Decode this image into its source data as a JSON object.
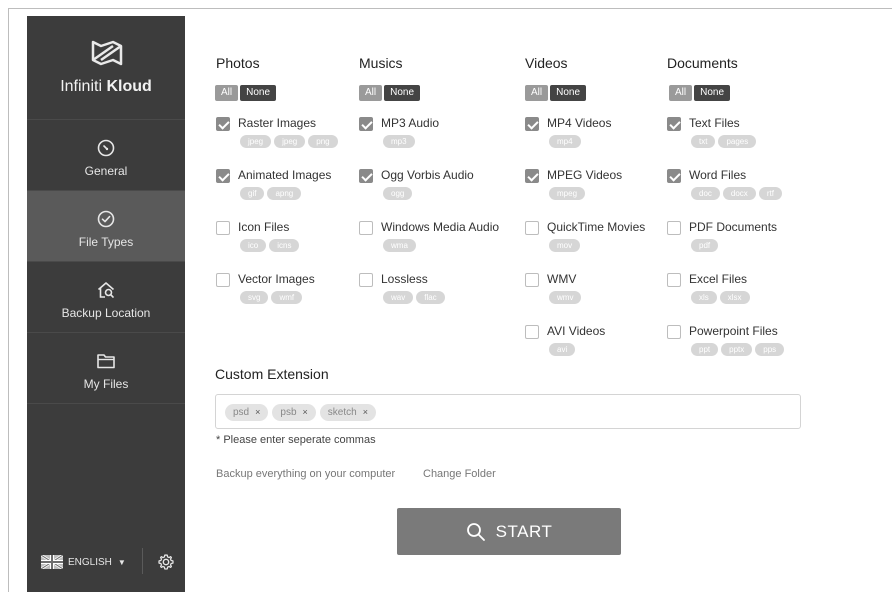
{
  "brand": {
    "name_light": "Infiniti ",
    "name_bold": "Kloud"
  },
  "nav": {
    "items": [
      {
        "label": "General",
        "icon": "gauge-icon",
        "active": false
      },
      {
        "label": "File Types",
        "icon": "check-circle-icon",
        "active": true
      },
      {
        "label": "Backup Location",
        "icon": "home-search-icon",
        "active": false
      },
      {
        "label": "My Files",
        "icon": "folder-icon",
        "active": false
      }
    ]
  },
  "footer": {
    "language": "ENGLISH",
    "flag": "uk-flag-icon",
    "settings_icon": "gear-icon"
  },
  "filetypes": {
    "all_label": "All",
    "none_label": "None",
    "columns": [
      {
        "title": "Photos",
        "items": [
          {
            "label": "Raster Images",
            "checked": true,
            "tags": [
              "jpeg",
              "jpeg",
              "png"
            ]
          },
          {
            "label": "Animated Images",
            "checked": true,
            "tags": [
              "gif",
              "apng"
            ]
          },
          {
            "label": "Icon Files",
            "checked": false,
            "tags": [
              "ico",
              "icns"
            ]
          },
          {
            "label": "Vector Images",
            "checked": false,
            "tags": [
              "svg",
              "wmf"
            ]
          }
        ]
      },
      {
        "title": "Musics",
        "items": [
          {
            "label": "MP3 Audio",
            "checked": true,
            "tags": [
              "mp3"
            ]
          },
          {
            "label": "Ogg Vorbis Audio",
            "checked": true,
            "tags": [
              "ogg"
            ]
          },
          {
            "label": "Windows Media Audio",
            "checked": false,
            "tags": [
              "wma"
            ]
          },
          {
            "label": "Lossless",
            "checked": false,
            "tags": [
              "wav",
              "flac"
            ]
          }
        ]
      },
      {
        "title": "Videos",
        "items": [
          {
            "label": "MP4 Videos",
            "checked": true,
            "tags": [
              "mp4"
            ]
          },
          {
            "label": "MPEG Videos",
            "checked": true,
            "tags": [
              "mpeg"
            ]
          },
          {
            "label": "QuickTime Movies",
            "checked": false,
            "tags": [
              "mov"
            ]
          },
          {
            "label": "WMV",
            "checked": false,
            "tags": [
              "wmv"
            ]
          },
          {
            "label": "AVI Videos",
            "checked": false,
            "tags": [
              "avi"
            ]
          }
        ]
      },
      {
        "title": "Documents",
        "items": [
          {
            "label": "Text Files",
            "checked": true,
            "tags": [
              "txt",
              "pages"
            ]
          },
          {
            "label": "Word Files",
            "checked": true,
            "tags": [
              "doc",
              "docx",
              "rtf"
            ]
          },
          {
            "label": "PDF Documents",
            "checked": false,
            "tags": [
              "pdf"
            ]
          },
          {
            "label": "Excel Files",
            "checked": false,
            "tags": [
              "xls",
              "xlsx"
            ]
          },
          {
            "label": "Powerpoint Files",
            "checked": false,
            "tags": [
              "ppt",
              "pptx",
              "pps"
            ]
          }
        ]
      }
    ]
  },
  "custom": {
    "title": "Custom Extension",
    "tags": [
      "psd",
      "psb",
      "sketch"
    ],
    "remove_symbol": "×",
    "hint": "* Please enter seperate commas"
  },
  "backup": {
    "text": "Backup everything on your computer",
    "change_folder": "Change Folder"
  },
  "start": {
    "label": "START",
    "icon": "search-icon"
  },
  "colors": {
    "sidebar": "#3c3c3c",
    "sidebar_active": "#5a5a5a",
    "button": "#7a7a7a",
    "checkbox_checked": "#8a8a8a"
  }
}
